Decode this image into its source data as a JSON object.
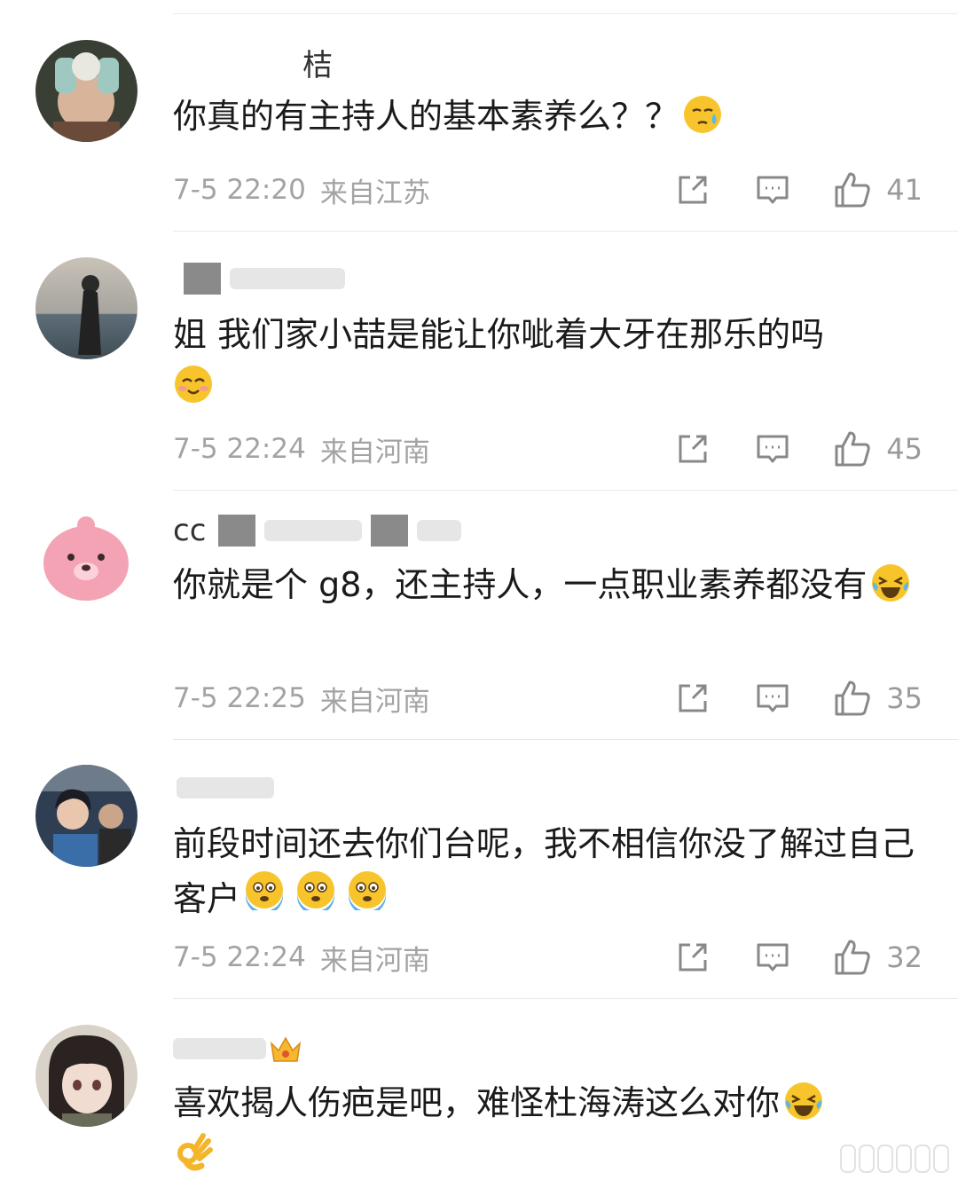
{
  "comments": [
    {
      "username": "桔",
      "text": "你真的有主持人的基本素养么？？",
      "emojis": [
        "sweat-face"
      ],
      "time": "7-5 22:20",
      "location": "来自江苏",
      "likes": "41"
    },
    {
      "username": "",
      "text": "姐 我们家小喆是能让你呲着大牙在那乐的吗",
      "emojis": [
        "smile-face"
      ],
      "time": "7-5 22:24",
      "location": "来自河南",
      "likes": "45"
    },
    {
      "username": "cc",
      "text": "你就是个 g8，还主持人，一点职业素养都没有",
      "emojis": [
        "laugh-cry-face"
      ],
      "time": "7-5 22:25",
      "location": "来自河南",
      "likes": "35"
    },
    {
      "username": "",
      "text": "前段时间还去你们台呢，我不相信你没了解过自己客户",
      "emojis": [
        "fear-face",
        "fear-face",
        "fear-face"
      ],
      "time": "7-5 22:24",
      "location": "来自河南",
      "likes": "32"
    },
    {
      "username": "",
      "text": "喜欢揭人伤疤是吧，难怪杜海涛这么对你",
      "emojis": [
        "laugh-cry-face",
        "ok-hand"
      ],
      "time": "",
      "location": "",
      "likes": ""
    }
  ],
  "icons": {
    "share": "share-icon",
    "reply": "comment-icon",
    "like": "thumbs-up-icon",
    "vip": "crown-icon"
  },
  "colors": {
    "meta_text": "#a3a3a3",
    "emoji_yellow": "#f7c52b"
  }
}
